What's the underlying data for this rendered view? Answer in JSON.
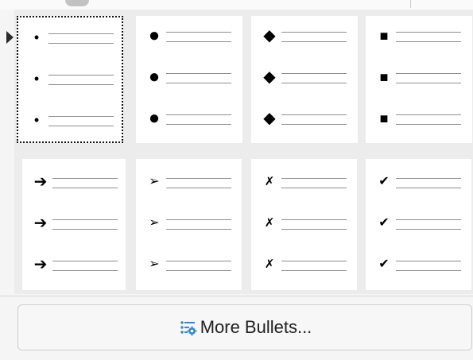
{
  "popup": {
    "bullet_styles": [
      {
        "glyph": "•",
        "icon": "small-dot-bullet-icon",
        "selected": true
      },
      {
        "glyph": "●",
        "icon": "large-circle-bullet-icon",
        "selected": false
      },
      {
        "glyph": "◆",
        "icon": "diamond-bullet-icon",
        "selected": false
      },
      {
        "glyph": "■",
        "icon": "square-bullet-icon",
        "selected": false
      },
      {
        "glyph": "➔",
        "icon": "arrow-bullet-icon",
        "selected": false
      },
      {
        "glyph": "➢",
        "icon": "triangle-arrow-bullet-icon",
        "selected": false
      },
      {
        "glyph": "✗",
        "icon": "cross-bullet-icon",
        "selected": false
      },
      {
        "glyph": "✔",
        "icon": "check-bullet-icon",
        "selected": false
      }
    ],
    "more_button": {
      "label": "More Bullets...",
      "icon": "bullet-settings-icon"
    },
    "colors": {
      "background": "#f5f5f5",
      "cell": "#ffffff",
      "line": "#8f8f8f",
      "icon_blue": "#3a86c8"
    }
  }
}
